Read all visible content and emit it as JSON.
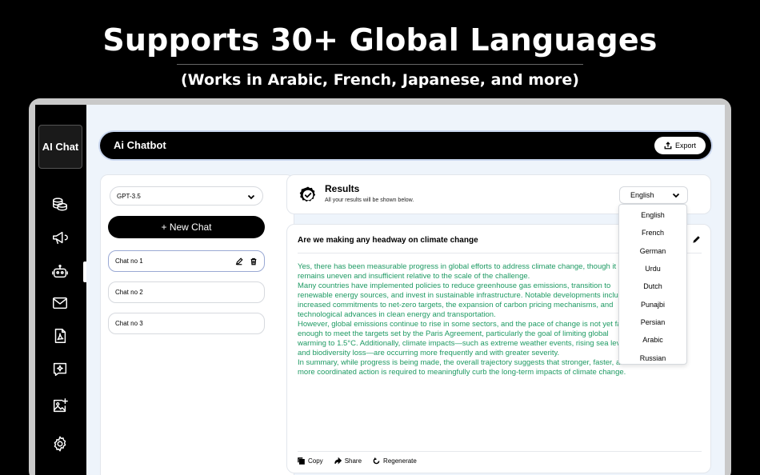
{
  "promo": {
    "title": "Supports 30+ Global Languages",
    "subtitle": "(Works in Arabic, French, Japanese, and more)"
  },
  "app": {
    "logo_text": "AI Chat",
    "title": "Ai Chatbot",
    "export_label": "Export"
  },
  "sidebar": {
    "icons": [
      "coins-icon",
      "megaphone-icon",
      "robot-icon",
      "mail-icon",
      "pdf-icon",
      "chat-star-icon",
      "image-add-icon",
      "gear-icon"
    ],
    "active": "robot-icon"
  },
  "chat_panel": {
    "model": "GPT-3.5",
    "new_chat_label": "+ New Chat",
    "chats": [
      {
        "label": "Chat no 1",
        "selected": true
      },
      {
        "label": "Chat no 2",
        "selected": false
      },
      {
        "label": "Chat no 3",
        "selected": false
      }
    ]
  },
  "results": {
    "title": "Results",
    "subtitle": "All your results will be shown below.",
    "language": "English"
  },
  "answer": {
    "question": "Are we making any headway on climate change",
    "paragraphs": [
      "Yes, there has been measurable progress in global efforts to address climate change, though it remains uneven and insufficient relative to the scale of the challenge.",
      "Many countries have implemented policies to reduce greenhouse gas emissions, transition to renewable energy sources, and invest in sustainable infrastructure. Notable developments include increased commitments to net-zero targets, the expansion of carbon pricing mechanisms, and technological advances in clean energy and transportation.",
      "However, global emissions continue to rise in some sectors, and the pace of change is not yet fast enough to meet the targets set by the Paris Agreement, particularly the goal of limiting global warming to 1.5°C. Additionally, climate impacts—such as extreme weather events, rising sea levels, and biodiversity loss—are occurring more frequently and with greater severity.",
      "In summary, while progress is being made, the overall trajectory suggests that stronger, faster, and more coordinated action is required to meaningfully curb the long-term impacts of climate change."
    ],
    "actions": {
      "copy": "Copy",
      "share": "Share",
      "regenerate": "Regenerate"
    }
  },
  "language_menu": [
    "English",
    "French",
    "German",
    "Urdu",
    "Dutch",
    "Punajbi",
    "Persian",
    "Arabic",
    "Russian"
  ],
  "colors": {
    "answer_text": "#1e9a63",
    "background": "#000000",
    "main_bg": "#eef4fb"
  }
}
